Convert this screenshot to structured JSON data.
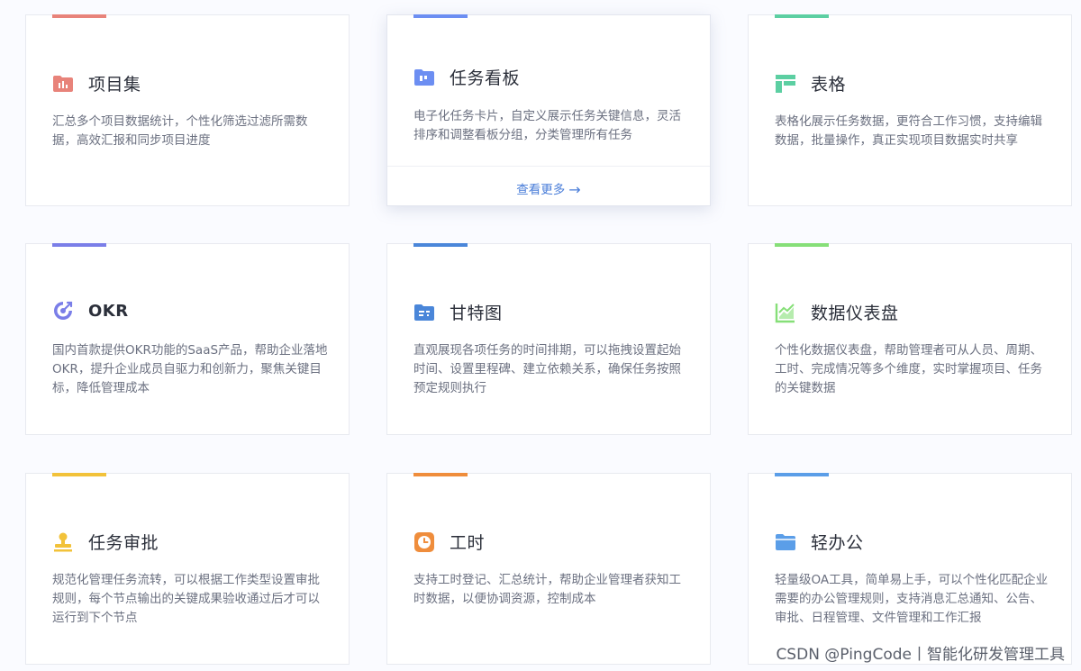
{
  "cards": [
    {
      "title": "项目集",
      "desc": "汇总多个项目数据统计，个性化筛选过滤所需数据，高效汇报和同步项目进度",
      "accent": "#e8837a",
      "icon": "project-set-icon"
    },
    {
      "title": "任务看板",
      "desc": "电子化任务卡片，自定义展示任务关键信息，灵活排序和调整看板分组，分类管理所有任务",
      "accent": "#6c8ef2",
      "icon": "kanban-icon",
      "more_label": "查看更多"
    },
    {
      "title": "表格",
      "desc": "表格化展示任务数据，更符合工作习惯，支持编辑数据，批量操作，真正实现项目数据实时共享",
      "accent": "#5ccfa2",
      "icon": "table-icon"
    },
    {
      "title": "OKR",
      "desc": "国内首款提供OKR功能的SaaS产品，帮助企业落地OKR，提升企业成员自驱力和创新力，聚焦关键目标，降低管理成本",
      "accent": "#7a7ee8",
      "icon": "okr-target-icon"
    },
    {
      "title": "甘特图",
      "desc": "直观展现各项任务的时间排期，可以拖拽设置起始时间、设置里程碑、建立依赖关系，确保任务按照预定规则执行",
      "accent": "#4a86d9",
      "icon": "gantt-icon"
    },
    {
      "title": "数据仪表盘",
      "desc": "个性化数据仪表盘，帮助管理者可从人员、周期、工时、完成情况等多个维度，实时掌握项目、任务的关键数据",
      "accent": "#86df78",
      "icon": "dashboard-chart-icon"
    },
    {
      "title": "任务审批",
      "desc": "规范化管理任务流转，可以根据工作类型设置审批规则，每个节点输出的关键成果验收通过后才可以运行到下个节点",
      "accent": "#f2c23a",
      "icon": "approval-stamp-icon"
    },
    {
      "title": "工时",
      "desc": "支持工时登记、汇总统计，帮助企业管理者获知工时数据，以便协调资源，控制成本",
      "accent": "#ef8d3c",
      "icon": "clock-icon"
    },
    {
      "title": "轻办公",
      "desc": "轻量级OA工具，简单易上手，可以个性化匹配企业需要的办公管理规则，支持消息汇总通知、公告、审批、日程管理、文件管理和工作汇报",
      "accent": "#5b9ee8",
      "icon": "folder-icon"
    }
  ],
  "watermark": "CSDN @PingCode丨智能化研发管理工具"
}
